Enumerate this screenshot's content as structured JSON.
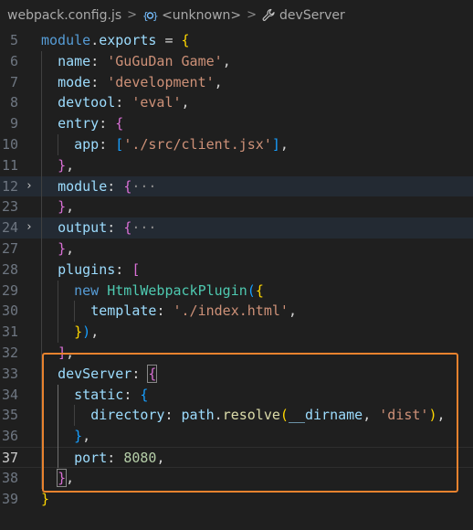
{
  "breadcrumb": {
    "file": "webpack.config.js",
    "object_icon": "{⊗}",
    "object": "<unknown>",
    "property": "devServer"
  },
  "editor": {
    "lines": [
      {
        "n": "5",
        "fold": "",
        "tokens": [
          [
            "kw",
            "module"
          ],
          [
            "p",
            "."
          ],
          [
            "prop",
            "exports"
          ],
          [
            "p",
            " = "
          ],
          [
            "b1",
            "{"
          ]
        ]
      },
      {
        "n": "6",
        "fold": "",
        "tokens": [
          [
            "p",
            "  "
          ],
          [
            "prop",
            "name"
          ],
          [
            "p",
            ": "
          ],
          [
            "str",
            "'GuGuDan Game'"
          ],
          [
            "p",
            ","
          ]
        ]
      },
      {
        "n": "7",
        "fold": "",
        "tokens": [
          [
            "p",
            "  "
          ],
          [
            "prop",
            "mode"
          ],
          [
            "p",
            ": "
          ],
          [
            "str",
            "'development'"
          ],
          [
            "p",
            ","
          ]
        ]
      },
      {
        "n": "8",
        "fold": "",
        "tokens": [
          [
            "p",
            "  "
          ],
          [
            "prop",
            "devtool"
          ],
          [
            "p",
            ": "
          ],
          [
            "str",
            "'eval'"
          ],
          [
            "p",
            ","
          ]
        ]
      },
      {
        "n": "9",
        "fold": "",
        "tokens": [
          [
            "p",
            "  "
          ],
          [
            "prop",
            "entry"
          ],
          [
            "p",
            ": "
          ],
          [
            "b2",
            "{"
          ]
        ]
      },
      {
        "n": "10",
        "fold": "",
        "tokens": [
          [
            "p",
            "    "
          ],
          [
            "prop",
            "app"
          ],
          [
            "p",
            ": "
          ],
          [
            "b3",
            "["
          ],
          [
            "str",
            "'./src/client.jsx'"
          ],
          [
            "b3",
            "]"
          ],
          [
            "p",
            ","
          ]
        ]
      },
      {
        "n": "11",
        "fold": "",
        "tokens": [
          [
            "p",
            "  "
          ],
          [
            "b2",
            "}"
          ],
          [
            "p",
            ","
          ]
        ]
      },
      {
        "n": "12",
        "fold": "›",
        "hl": true,
        "tokens": [
          [
            "p",
            "  "
          ],
          [
            "prop",
            "module"
          ],
          [
            "p",
            ": "
          ],
          [
            "b2",
            "{"
          ],
          [
            "ell",
            "···"
          ]
        ]
      },
      {
        "n": "23",
        "fold": "",
        "tokens": [
          [
            "p",
            "  "
          ],
          [
            "b2",
            "}"
          ],
          [
            "p",
            ","
          ]
        ]
      },
      {
        "n": "24",
        "fold": "›",
        "hl": true,
        "tokens": [
          [
            "p",
            "  "
          ],
          [
            "prop",
            "output"
          ],
          [
            "p",
            ": "
          ],
          [
            "b2",
            "{"
          ],
          [
            "ell",
            "···"
          ]
        ]
      },
      {
        "n": "27",
        "fold": "",
        "tokens": [
          [
            "p",
            "  "
          ],
          [
            "b2",
            "}"
          ],
          [
            "p",
            ","
          ]
        ]
      },
      {
        "n": "28",
        "fold": "",
        "tokens": [
          [
            "p",
            "  "
          ],
          [
            "prop",
            "plugins"
          ],
          [
            "p",
            ": "
          ],
          [
            "b2",
            "["
          ]
        ]
      },
      {
        "n": "29",
        "fold": "",
        "tokens": [
          [
            "p",
            "    "
          ],
          [
            "kw",
            "new"
          ],
          [
            "p",
            " "
          ],
          [
            "cls",
            "HtmlWebpackPlugin"
          ],
          [
            "b3",
            "("
          ],
          [
            "b1",
            "{"
          ]
        ]
      },
      {
        "n": "30",
        "fold": "",
        "tokens": [
          [
            "p",
            "      "
          ],
          [
            "prop",
            "template"
          ],
          [
            "p",
            ": "
          ],
          [
            "str",
            "'./index.html'"
          ],
          [
            "p",
            ","
          ]
        ]
      },
      {
        "n": "31",
        "fold": "",
        "tokens": [
          [
            "p",
            "    "
          ],
          [
            "b1",
            "}"
          ],
          [
            "b3",
            ")"
          ],
          [
            "p",
            ","
          ]
        ]
      },
      {
        "n": "32",
        "fold": "",
        "tokens": [
          [
            "p",
            "  "
          ],
          [
            "b2",
            "]"
          ],
          [
            "p",
            ","
          ]
        ]
      },
      {
        "n": "33",
        "fold": "",
        "tokens": [
          [
            "p",
            "  "
          ],
          [
            "prop",
            "devServer"
          ],
          [
            "p",
            ": "
          ],
          [
            "b2m",
            "{"
          ]
        ]
      },
      {
        "n": "34",
        "fold": "",
        "tokens": [
          [
            "p",
            "    "
          ],
          [
            "prop",
            "static"
          ],
          [
            "p",
            ": "
          ],
          [
            "b3",
            "{"
          ]
        ]
      },
      {
        "n": "35",
        "fold": "",
        "tokens": [
          [
            "p",
            "      "
          ],
          [
            "prop",
            "directory"
          ],
          [
            "p",
            ": "
          ],
          [
            "prop",
            "path"
          ],
          [
            "p",
            "."
          ],
          [
            "fn",
            "resolve"
          ],
          [
            "b1",
            "("
          ],
          [
            "prop",
            "__dirname"
          ],
          [
            "p",
            ", "
          ],
          [
            "str",
            "'dist'"
          ],
          [
            "b1",
            ")"
          ],
          [
            "p",
            ","
          ]
        ]
      },
      {
        "n": "36",
        "fold": "",
        "tokens": [
          [
            "p",
            "    "
          ],
          [
            "b3",
            "}"
          ],
          [
            "p",
            ","
          ]
        ]
      },
      {
        "n": "37",
        "fold": "",
        "cur": true,
        "tokens": [
          [
            "p",
            "    "
          ],
          [
            "prop",
            "port"
          ],
          [
            "p",
            ": "
          ],
          [
            "num",
            "8080"
          ],
          [
            "p",
            ","
          ]
        ]
      },
      {
        "n": "38",
        "fold": "",
        "tokens": [
          [
            "p",
            "  "
          ],
          [
            "b2m",
            "}"
          ],
          [
            "p",
            ","
          ]
        ]
      },
      {
        "n": "39",
        "fold": "",
        "tokens": [
          [
            "b1",
            "}"
          ]
        ]
      }
    ]
  },
  "colors": {
    "background": "#1f1f1f",
    "highlight_box": "#e8822e",
    "folded_line": "#232a33"
  }
}
